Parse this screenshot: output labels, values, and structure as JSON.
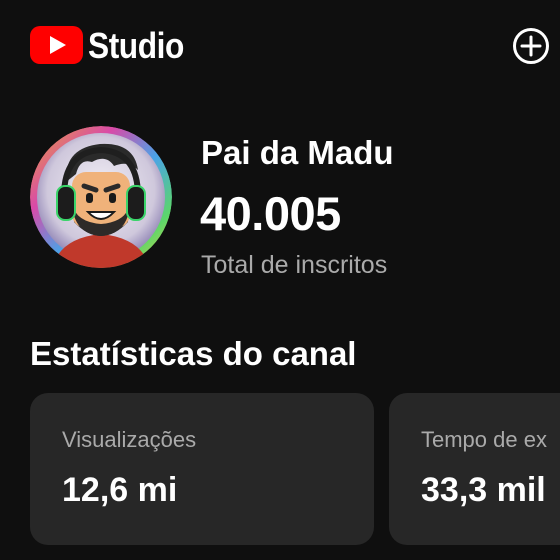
{
  "header": {
    "logo_icon": "youtube-play-icon",
    "app_name": "Studio",
    "add_icon": "plus-circle-icon"
  },
  "channel": {
    "name": "Pai da Madu",
    "subscriber_count": "40.005",
    "subscriber_label": "Total de inscritos",
    "avatar_icon": "channel-avatar"
  },
  "stats": {
    "title": "Estatísticas do canal",
    "cards": [
      {
        "label": "Visualizações",
        "value": "12,6 mi"
      },
      {
        "label": "Tempo de ex",
        "value": "33,3 mil"
      }
    ]
  },
  "colors": {
    "background": "#0f0f0f",
    "card": "#272727",
    "youtube_red": "#ff0000",
    "secondary_text": "#aaaaaa"
  }
}
